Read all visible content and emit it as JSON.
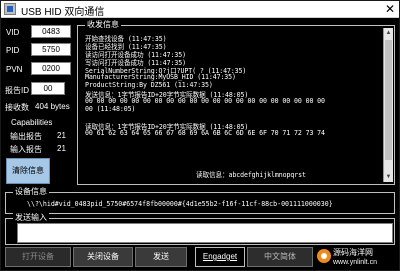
{
  "window": {
    "title": "USB HID 双向通信",
    "close_glyph": "✕"
  },
  "left_panel": {
    "vid_label": "VID",
    "vid_value": "0483",
    "pid_label": "PID",
    "pid_value": "5750",
    "pvn_label": "PVN",
    "pvn_value": "0200",
    "report_id_label": "报告ID",
    "report_id_value": "00",
    "bytes_received_label": "接收数",
    "bytes_received_value": "404 bytes",
    "capabilities_label": "Capabilities",
    "output_report_label": "输出报告",
    "output_report_value": "21",
    "input_report_label": "输入报告",
    "input_report_value": "21",
    "clear_button": "清除信息"
  },
  "receive_group": {
    "title": "收发信息",
    "lines": [
      "开始查找设备 (11:47:35)",
      "设备已经找到 (11:47:35)",
      "读访问打开设备成功 (11:47:35)",
      "写访问打开设备成功 (11:47:35)",
      "SerialNumberString:Q?j口?UPT( ? (11:47:35)",
      "ManufacturerString:MyUSB_HID (11:47:35)",
      "ProductString:By DZ561 (11:47:35)",
      "发送信息：1字节报告ID+20字节实际数据 (11:48:05)",
      "00 00 00 00 00 00 00 00 00 00 00 00 00 00 00 00 00 00 00 00 00",
      "00 (11:48:05)",
      "读取信息：1字节报告ID+20字节实际数据 (11:48:05)",
      "00 61 62 63 64 65 66 67 68 69 6A 6B 6C 6D 6E 6F 70 71 72 73 74",
      "读取信息：abcdefghijklmnopqrst"
    ]
  },
  "device_group": {
    "title": "设备信息",
    "path": "\\\\?\\hid#vid_0483pid_5750#6574f8fb00000#{4d1e55b2-f16f-11cf-88cb-001111000030}"
  },
  "send_group": {
    "title": "发送输入",
    "value": ""
  },
  "buttons": {
    "open": "打开设备",
    "close_device": "关闭设备",
    "send": "发送",
    "english": "Engadget",
    "language": "中文简体"
  },
  "watermark": {
    "text": "源码海洋网",
    "url": "www.ynlinlt.cn"
  }
}
